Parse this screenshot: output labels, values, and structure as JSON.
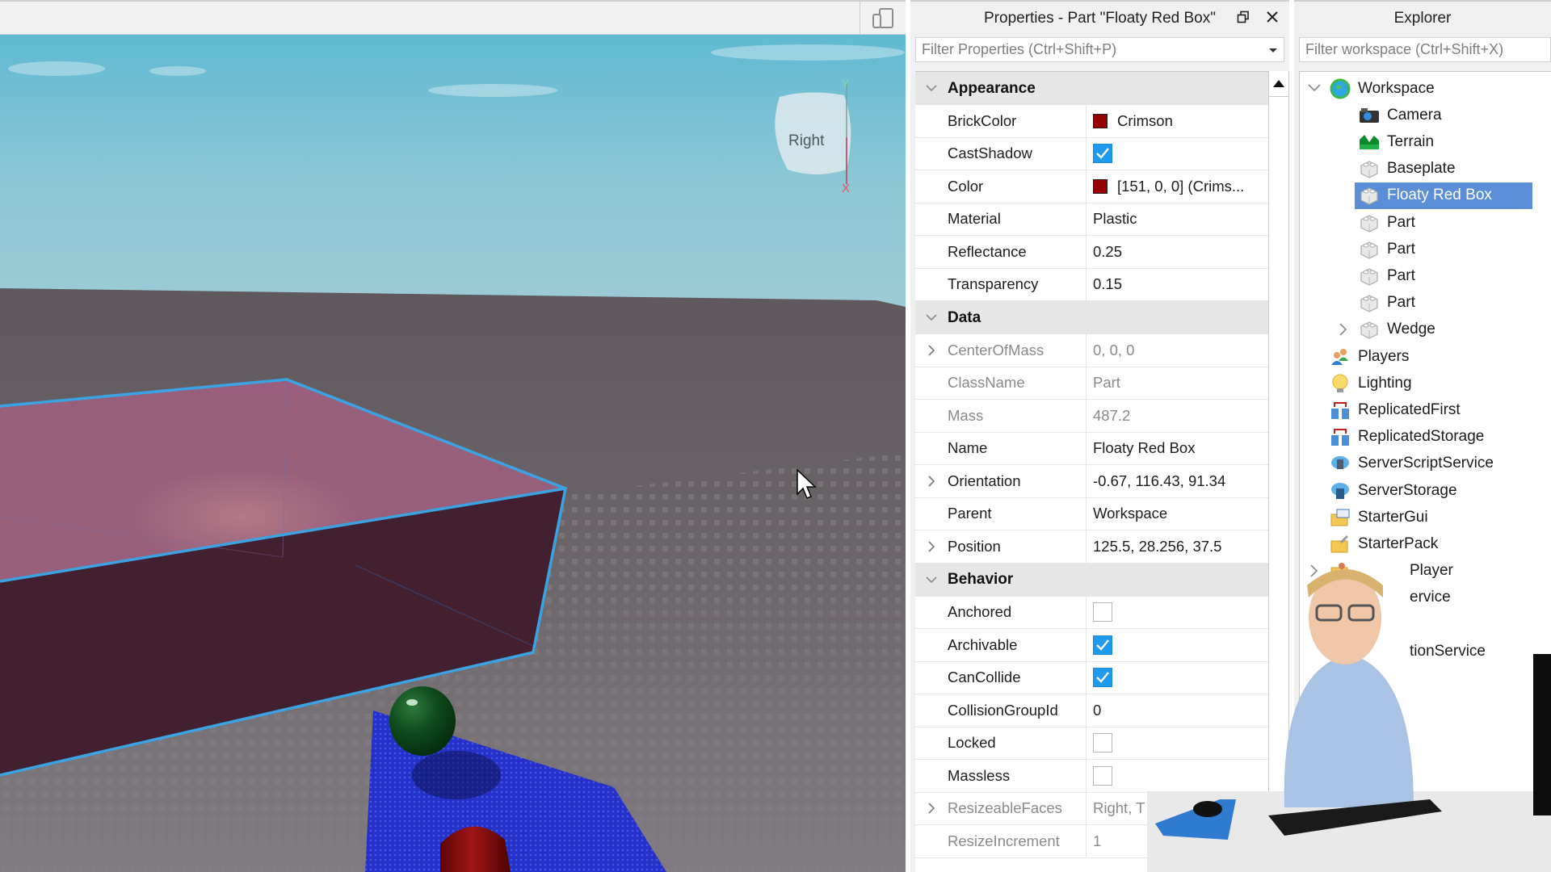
{
  "viewport": {
    "view_cube_label": "Right",
    "axis_y_label": "Y",
    "axis_x_label": "X",
    "device_emulator_icon": "device-emulator-icon"
  },
  "properties": {
    "title": "Properties - Part \"Floaty Red Box\"",
    "filter_placeholder": "Filter Properties (Ctrl+Shift+P)",
    "categories": [
      {
        "name": "Appearance",
        "rows": [
          {
            "name": "BrickColor",
            "type": "color",
            "value": "Crimson",
            "swatch": "#970000"
          },
          {
            "name": "CastShadow",
            "type": "bool",
            "checked": true
          },
          {
            "name": "Color",
            "type": "color",
            "value": "[151, 0, 0] (Crims...",
            "swatch": "#970000"
          },
          {
            "name": "Material",
            "type": "text",
            "value": "Plastic"
          },
          {
            "name": "Reflectance",
            "type": "text",
            "value": "0.25"
          },
          {
            "name": "Transparency",
            "type": "text",
            "value": "0.15"
          }
        ]
      },
      {
        "name": "Data",
        "rows": [
          {
            "name": "CenterOfMass",
            "type": "text",
            "value": "0, 0, 0",
            "readonly": true,
            "expandable": true
          },
          {
            "name": "ClassName",
            "type": "text",
            "value": "Part",
            "readonly": true
          },
          {
            "name": "Mass",
            "type": "text",
            "value": "487.2",
            "readonly": true
          },
          {
            "name": "Name",
            "type": "text",
            "value": "Floaty Red Box"
          },
          {
            "name": "Orientation",
            "type": "text",
            "value": "-0.67, 116.43, 91.34",
            "expandable": true
          },
          {
            "name": "Parent",
            "type": "text",
            "value": "Workspace"
          },
          {
            "name": "Position",
            "type": "text",
            "value": "125.5, 28.256, 37.5",
            "expandable": true
          }
        ]
      },
      {
        "name": "Behavior",
        "rows": [
          {
            "name": "Anchored",
            "type": "bool",
            "checked": false
          },
          {
            "name": "Archivable",
            "type": "bool",
            "checked": true
          },
          {
            "name": "CanCollide",
            "type": "bool",
            "checked": true
          },
          {
            "name": "CollisionGroupId",
            "type": "text",
            "value": "0"
          },
          {
            "name": "Locked",
            "type": "bool",
            "checked": false
          },
          {
            "name": "Massless",
            "type": "bool",
            "checked": false
          },
          {
            "name": "ResizeableFaces",
            "type": "text",
            "value": "Right, T",
            "readonly": true,
            "expandable": true
          },
          {
            "name": "ResizeIncrement",
            "type": "text",
            "value": "1",
            "readonly": true
          }
        ]
      }
    ]
  },
  "explorer": {
    "title": "Explorer",
    "filter_placeholder": "Filter workspace (Ctrl+Shift+X)",
    "items": [
      {
        "label": "Workspace",
        "icon": "workspace-globe-icon",
        "depth": 0,
        "expander": "expanded"
      },
      {
        "label": "Camera",
        "icon": "camera-icon",
        "depth": 1
      },
      {
        "label": "Terrain",
        "icon": "terrain-icon",
        "depth": 1
      },
      {
        "label": "Baseplate",
        "icon": "part-brick-icon",
        "depth": 1
      },
      {
        "label": "Floaty Red Box",
        "icon": "part-brick-icon",
        "depth": 1,
        "selected": true
      },
      {
        "label": "Part",
        "icon": "part-brick-icon",
        "depth": 1
      },
      {
        "label": "Part",
        "icon": "part-brick-icon",
        "depth": 1
      },
      {
        "label": "Part",
        "icon": "part-brick-icon",
        "depth": 1
      },
      {
        "label": "Part",
        "icon": "part-brick-icon",
        "depth": 1
      },
      {
        "label": "Wedge",
        "icon": "part-brick-icon",
        "depth": 1,
        "expander": "collapsed"
      },
      {
        "label": "Players",
        "icon": "players-icon",
        "depth": 0
      },
      {
        "label": "Lighting",
        "icon": "lighting-bulb-icon",
        "depth": 0
      },
      {
        "label": "ReplicatedFirst",
        "icon": "replicated-first-icon",
        "depth": 0
      },
      {
        "label": "ReplicatedStorage",
        "icon": "replicated-storage-icon",
        "depth": 0
      },
      {
        "label": "ServerScriptService",
        "icon": "server-script-service-icon",
        "depth": 0
      },
      {
        "label": "ServerStorage",
        "icon": "server-storage-icon",
        "depth": 0
      },
      {
        "label": "StarterGui",
        "icon": "starter-gui-icon",
        "depth": 0
      },
      {
        "label": "StarterPack",
        "icon": "starter-pack-icon",
        "depth": 0
      },
      {
        "label": "Player",
        "icon": "starter-player-icon",
        "depth": 0,
        "expander": "collapsed",
        "obscured_prefix": true
      },
      {
        "label": "ervice",
        "icon": "sound-service-icon",
        "depth": 0,
        "obscured_prefix": true
      },
      {
        "label": "",
        "icon": "chat-icon",
        "depth": 0,
        "obscured_prefix": true
      },
      {
        "label": "tionService",
        "icon": "localization-service-icon",
        "depth": 0,
        "obscured_prefix": true
      }
    ]
  },
  "colors": {
    "selection_outline": "#3aa3e3",
    "explorer_selection": "#5b8ed6",
    "checkbox_on": "#1e9bf0",
    "crimson": "#970000"
  }
}
